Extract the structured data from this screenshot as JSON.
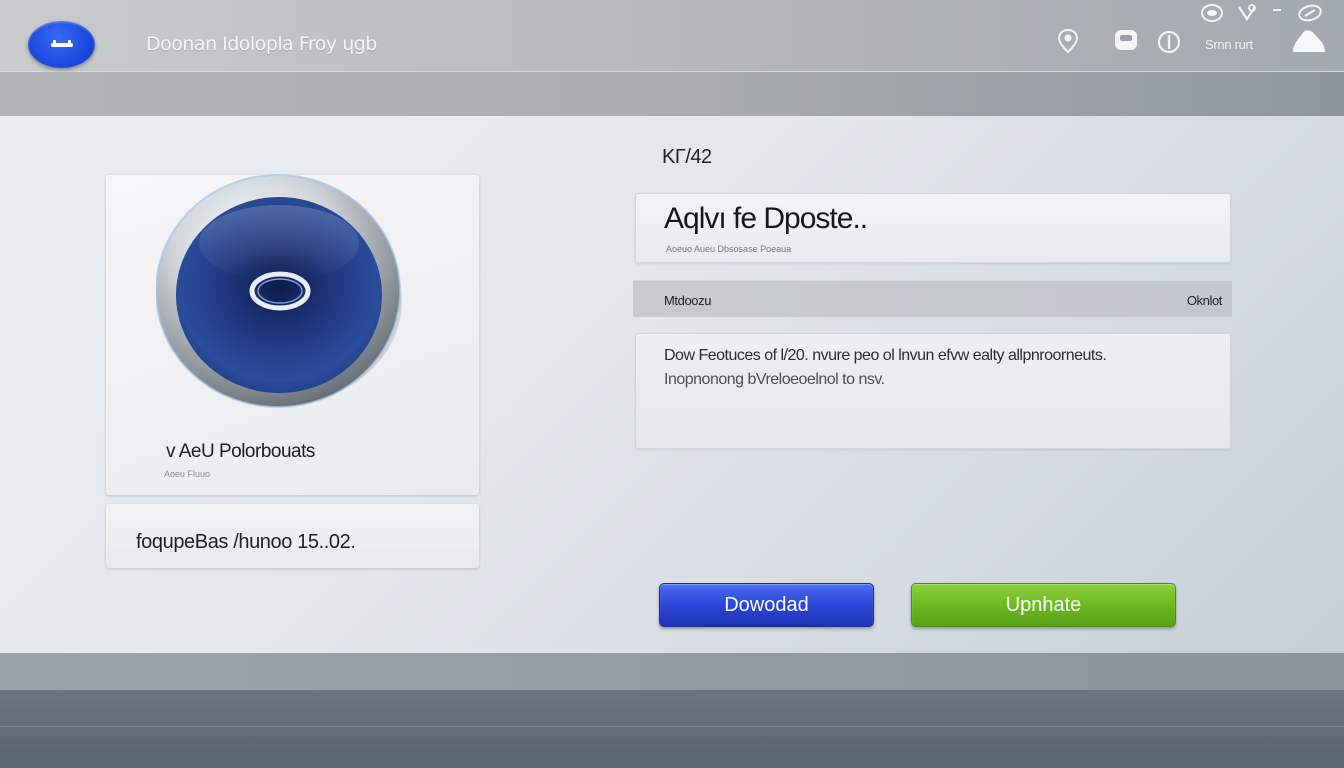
{
  "header": {
    "app_title": "Doonan Idolopla Froy ɥgb",
    "status_text": "Srnn rurt",
    "icons": [
      "location-icon",
      "chat-icon",
      "info-icon",
      "user-icon",
      "network-icon",
      "minimize-icon",
      "link-icon",
      "cloud-icon"
    ]
  },
  "app_card": {
    "name": "v AeU Polorbouats",
    "subtitle": "Aoeu Fluuo",
    "version": "foqupeBas /hunoo 15..02."
  },
  "details": {
    "section_label": "KΓ/42",
    "title": "Aqlvı fe Dposte..",
    "title_sub": "Aoeuo Aueu  Dbsosase Poeaua",
    "meta_left": "Mtdoozu",
    "meta_right": "Oknlot",
    "description_line1": "Dow Feotuces of l/20. nvure peo ol lnvun efvw ealty allpnroorneuts.",
    "description_line2": "Inopnonong bVreloeoelnol to nsv."
  },
  "buttons": {
    "download_label": "Dowodad",
    "update_label": "Upnhate"
  },
  "colors": {
    "accent_blue": "#2a46d8",
    "accent_green": "#6ab820"
  }
}
